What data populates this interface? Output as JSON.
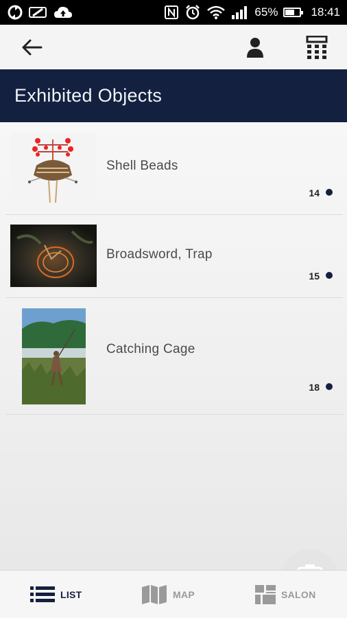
{
  "status_bar": {
    "battery": "65%",
    "battery_level": 0.65,
    "time": "18:41",
    "left_icons": [
      "sync-icon",
      "battery-saver-icon",
      "cloud-upload-icon"
    ],
    "right_icons": [
      "nfc-icon",
      "alarm-icon",
      "wifi-icon",
      "signal-icon"
    ]
  },
  "toolbar": {
    "icons": [
      "back-arrow-icon",
      "user-icon",
      "calculator-icon"
    ]
  },
  "header": {
    "title": "Exhibited Objects"
  },
  "objects": [
    {
      "name": "Shell Beads",
      "number": "14"
    },
    {
      "name": "Broadsword, Trap",
      "number": "15"
    },
    {
      "name": "Catching Cage",
      "number": "18"
    }
  ],
  "tabs": [
    {
      "label": "LIST",
      "icon": "list-icon",
      "active": true
    },
    {
      "label": "MAP",
      "icon": "map-icon",
      "active": false
    },
    {
      "label": "SALON",
      "icon": "salon-grid-icon",
      "active": false
    }
  ],
  "colors": {
    "header_bg": "#14203f",
    "accent": "#14203f",
    "inactive": "#9a9a9a"
  }
}
